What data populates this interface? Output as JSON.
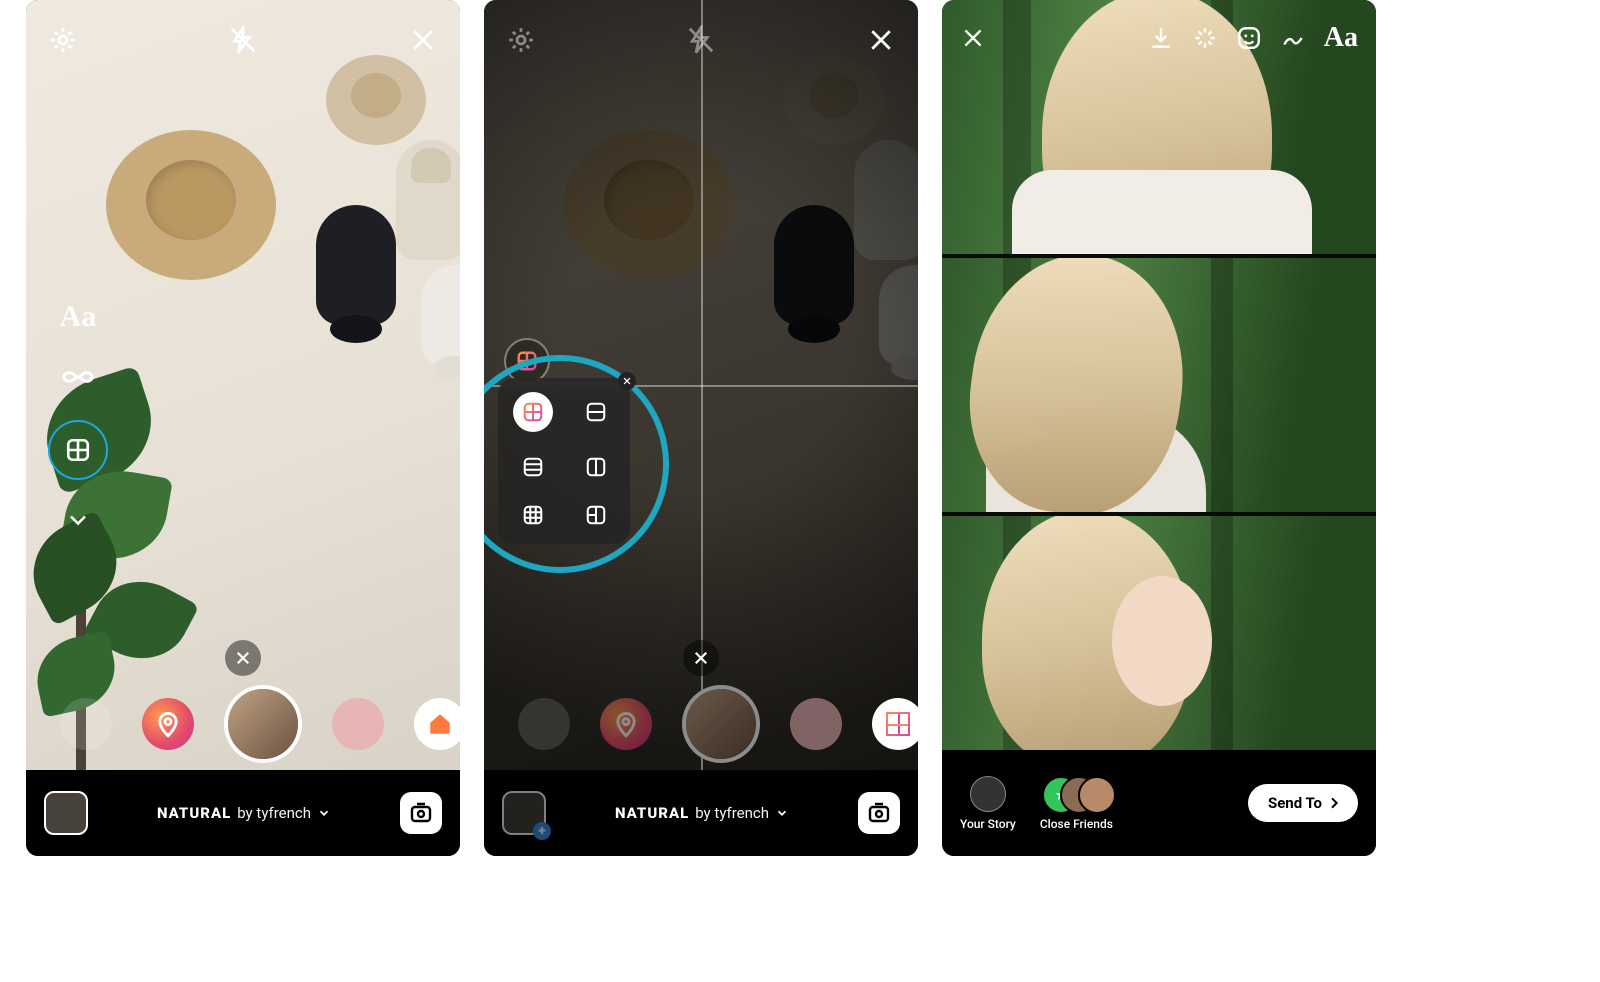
{
  "screens": {
    "camera": {
      "tools": {
        "text": "Aa"
      },
      "filter": {
        "name": "NATURAL",
        "byPrefix": "by",
        "author": "tyfrench"
      }
    },
    "layout": {
      "filter": {
        "name": "NATURAL",
        "byPrefix": "by",
        "author": "tyfrench"
      },
      "options": [
        "grid-2x2",
        "rows-2",
        "rows-3",
        "cols-2",
        "grid-3x3",
        "grid-1-2"
      ]
    },
    "share": {
      "tools": {
        "text": "Aa"
      },
      "yourStory": "Your Story",
      "closeFriends": "Close Friends",
      "sendTo": "Send To"
    }
  }
}
